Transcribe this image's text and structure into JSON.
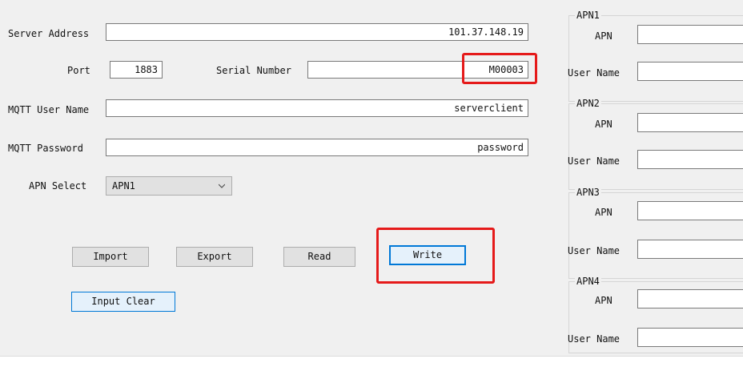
{
  "form": {
    "server_address_label": "Server Address",
    "server_address_value": "101.37.148.19",
    "port_label": "Port",
    "port_value": "1883",
    "serial_number_label": "Serial Number",
    "serial_number_value": "M00003",
    "mqtt_user_label": "MQTT User Name",
    "mqtt_user_value": "serverclient",
    "mqtt_password_label": "MQTT Password",
    "mqtt_password_value": "password",
    "apn_select_label": "APN Select",
    "apn_select_value": "APN1"
  },
  "buttons": {
    "import": "Import",
    "export": "Export",
    "read": "Read",
    "write": "Write",
    "input_clear": "Input Clear"
  },
  "apn_groups": [
    {
      "title": "APN1",
      "apn_label": "APN",
      "user_label": "User Name",
      "apn_value": "",
      "user_value": ""
    },
    {
      "title": "APN2",
      "apn_label": "APN",
      "user_label": "User Name",
      "apn_value": "",
      "user_value": ""
    },
    {
      "title": "APN3",
      "apn_label": "APN",
      "user_label": "User Name",
      "apn_value": "",
      "user_value": ""
    },
    {
      "title": "APN4",
      "apn_label": "APN",
      "user_label": "User Name",
      "apn_value": "",
      "user_value": ""
    }
  ],
  "colors": {
    "window_bg": "#f0f0f0",
    "highlight": "#e51a1a",
    "focus_border": "#0078d7"
  },
  "icons": {
    "dropdown": "chevron-down-icon"
  }
}
